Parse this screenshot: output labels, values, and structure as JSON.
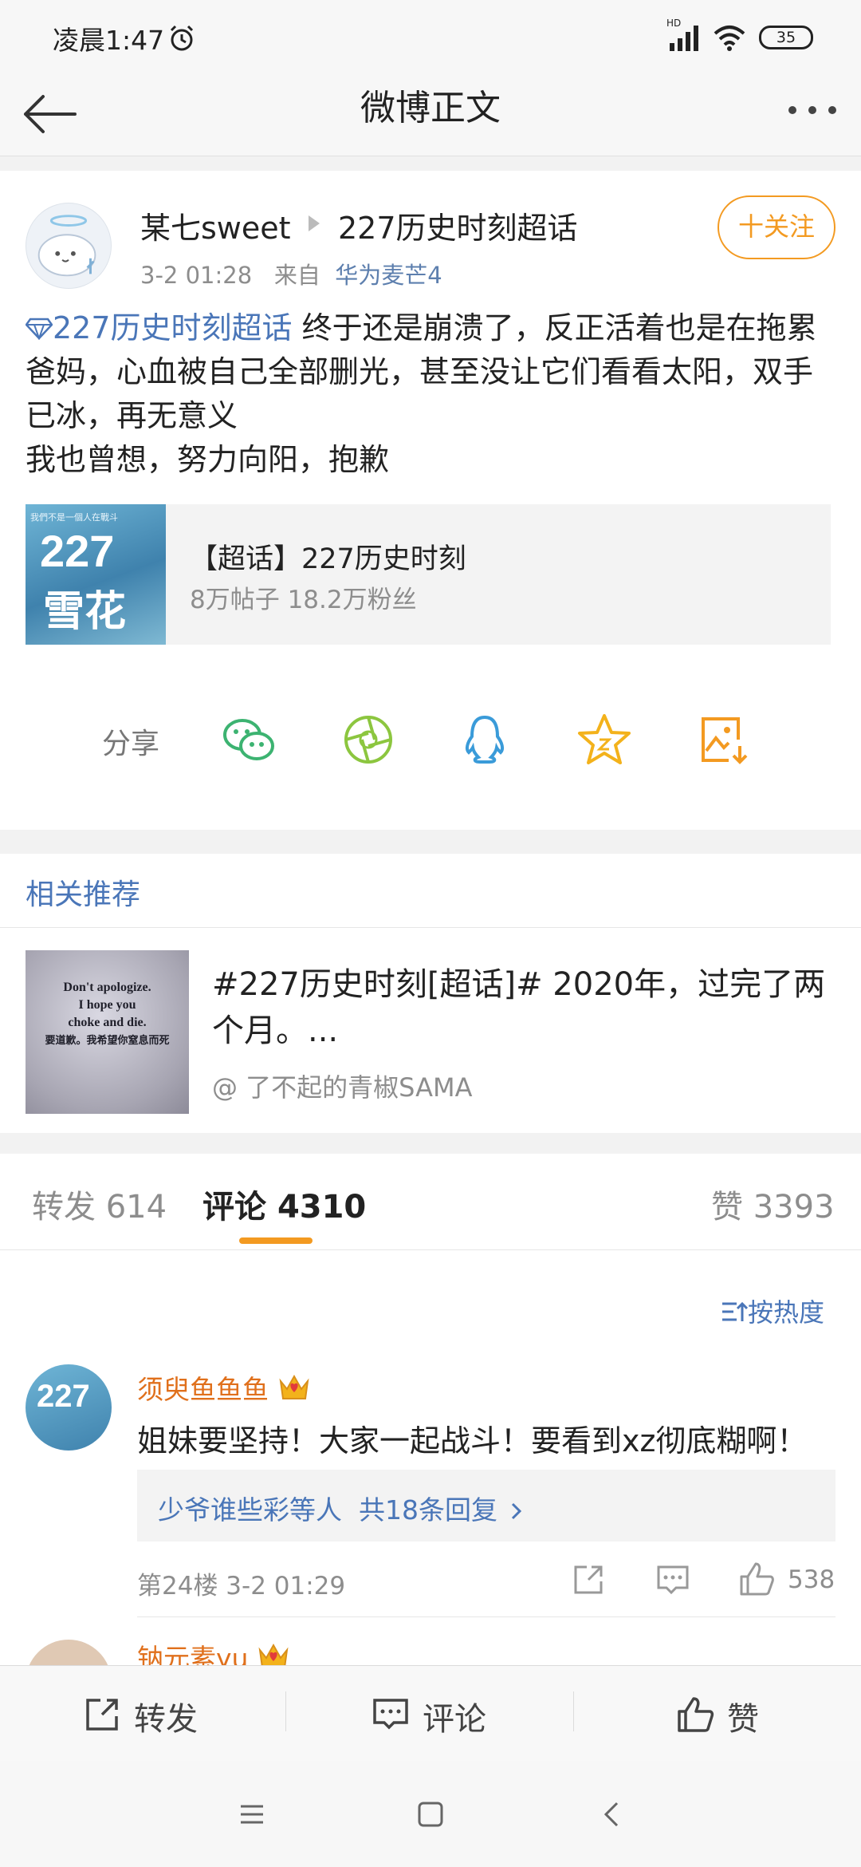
{
  "status_bar": {
    "time": "凌晨1:47",
    "network": "HD",
    "battery": "35"
  },
  "header": {
    "title": "微博正文"
  },
  "post": {
    "username": "某七sweet",
    "topic": "227历史时刻超话",
    "time": "3-2 01:28",
    "source_prefix": "来自",
    "device": "华为麦芒4",
    "follow_label": "十关注",
    "topic_link": "227历史时刻超话",
    "text_line1": " 终于还是崩溃了，反正活着也是在拖累爸妈，心血被自己全部删光，甚至没让它们看看太阳，双手已冰，再无意义",
    "text_line2": "我也曾想，努力向阳，抱歉",
    "supertopic": {
      "title": "【超话】227历史时刻",
      "stats": "8万帖子 18.2万粉丝",
      "thumb_top": "我們不是一個人在戰斗",
      "thumb_big": "227",
      "thumb_sub": "雪花"
    },
    "share_label": "分享"
  },
  "recommendation": {
    "heading": "相关推荐",
    "title": "#227历史时刻[超话]# 2020年，过完了两个月。...",
    "author": "@ 了不起的青椒SAMA",
    "thumb_line1": "Don't apologize.",
    "thumb_line2": "I hope you",
    "thumb_line3": "choke and die.",
    "thumb_line4": "要道歉。我希望你窒息而死"
  },
  "tabs": {
    "reposts_label": "转发",
    "reposts_count": "614",
    "comments_label": "评论",
    "comments_count": "4310",
    "likes_label": "赞",
    "likes_count": "3393"
  },
  "comments": {
    "sort_label": "按热度",
    "items": [
      {
        "user": "须臾鱼鱼鱼",
        "text": "姐妹要坚持！大家一起战斗！要看到xz彻底糊啊！",
        "reply_users": "少爷谁些彩等人",
        "reply_count": "共18条回复",
        "floor_time": "第24楼 3-2 01:29",
        "likes": "538",
        "avatar_text": "227"
      },
      {
        "user": "钠元素yu"
      }
    ]
  },
  "action_bar": {
    "repost": "转发",
    "comment": "评论",
    "like": "赞"
  },
  "colors": {
    "accent_orange": "#f39a21",
    "link_blue": "#4a76b8",
    "username_orange": "#e0701c"
  }
}
